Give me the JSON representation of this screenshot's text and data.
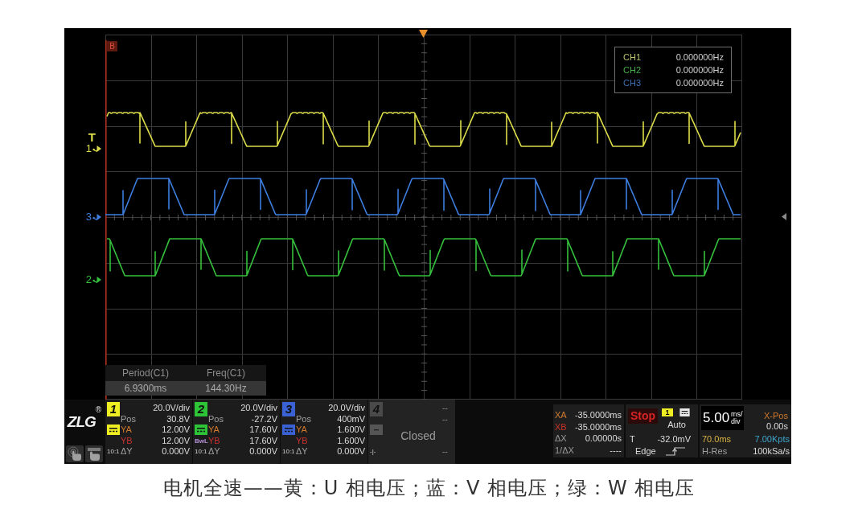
{
  "display": {
    "cursor_label": "B",
    "trigger_marker": "T",
    "traces": [
      {
        "label": "1",
        "color": "#dcdc4a"
      },
      {
        "label": "3",
        "color": "#3d7ee0"
      },
      {
        "label": "2",
        "color": "#34c03c"
      }
    ],
    "frequency_counter": [
      {
        "name": "CH1",
        "value": "0.000000Hz",
        "color": "#bcc46a"
      },
      {
        "name": "CH2",
        "value": "0.000000Hz",
        "color": "#46b04a"
      },
      {
        "name": "CH3",
        "value": "0.000000Hz",
        "color": "#3f6fb4"
      }
    ],
    "measurements": [
      {
        "label": "Period(C1)",
        "value": "6.9300ms"
      },
      {
        "label": "Freq(C1)",
        "value": "144.30Hz"
      }
    ]
  },
  "logo": {
    "text": "ZLG",
    "mark": "®"
  },
  "channels": [
    {
      "kind": "open",
      "number": "1",
      "color": "#eeee22",
      "scale": "20.0V/div",
      "pos_label": "Pos",
      "pos": "30.8V",
      "ya_label": "YA",
      "ya": "12.00V",
      "yb_label": "YB",
      "yb": "12.00V",
      "dy_label": "ΔY",
      "dy": "0.000V",
      "probe": "10:1"
    },
    {
      "kind": "open",
      "number": "2",
      "color": "#2ec437",
      "scale": "20.0V/div",
      "pos_label": "Pos",
      "pos": "-27.2V",
      "ya_label": "YA",
      "ya": "17.60V",
      "yb_label": "YB",
      "yb": "17.60V",
      "dy_label": "ΔY",
      "dy": "0.000V",
      "probe": "10:1",
      "bandwidth_limit": "BwL"
    },
    {
      "kind": "open",
      "number": "3",
      "color": "#3a62d4",
      "scale": "20.0V/div",
      "pos_label": "Pos",
      "pos": "400mV",
      "ya_label": "YA",
      "ya": "1.600V",
      "yb_label": "YB",
      "yb": "1.600V",
      "dy_label": "ΔY",
      "dy": "0.000V",
      "probe": "10:1"
    },
    {
      "kind": "closed",
      "number": "4",
      "color": "#4a4a4a",
      "scale": "--",
      "pos": "--",
      "status": "Closed",
      "dy": "--",
      "probe": "-|-"
    }
  ],
  "cursors": [
    {
      "label": "XA",
      "value": "-35.0000ms",
      "color": "#d07a30"
    },
    {
      "label": "XB",
      "value": "-35.0000ms",
      "color": "#c83228"
    },
    {
      "label": "ΔX",
      "value": "0.00000s",
      "color": "#9a9a9a"
    },
    {
      "label": "1/ΔX",
      "value": "----",
      "color": "#9a9a9a"
    }
  ],
  "trigger": {
    "run_state": "Stop",
    "source": "1",
    "color": "#eeee22",
    "mode": "Auto",
    "threshold_label": "T",
    "threshold": "-32.0mV",
    "type": "Edge"
  },
  "timebase": {
    "scale": "5.00",
    "unit_top": "ms/",
    "unit_bottom": "div",
    "xpos_label": "X-Pos",
    "xpos": "0.00s",
    "duration": "70.0ms",
    "points": "7.00Kpts",
    "mode": "H-Res",
    "sample_rate": "100kSa/s"
  },
  "caption": "电机全速——黄：U 相电压；蓝：V 相电压；绿：W 相电压"
}
